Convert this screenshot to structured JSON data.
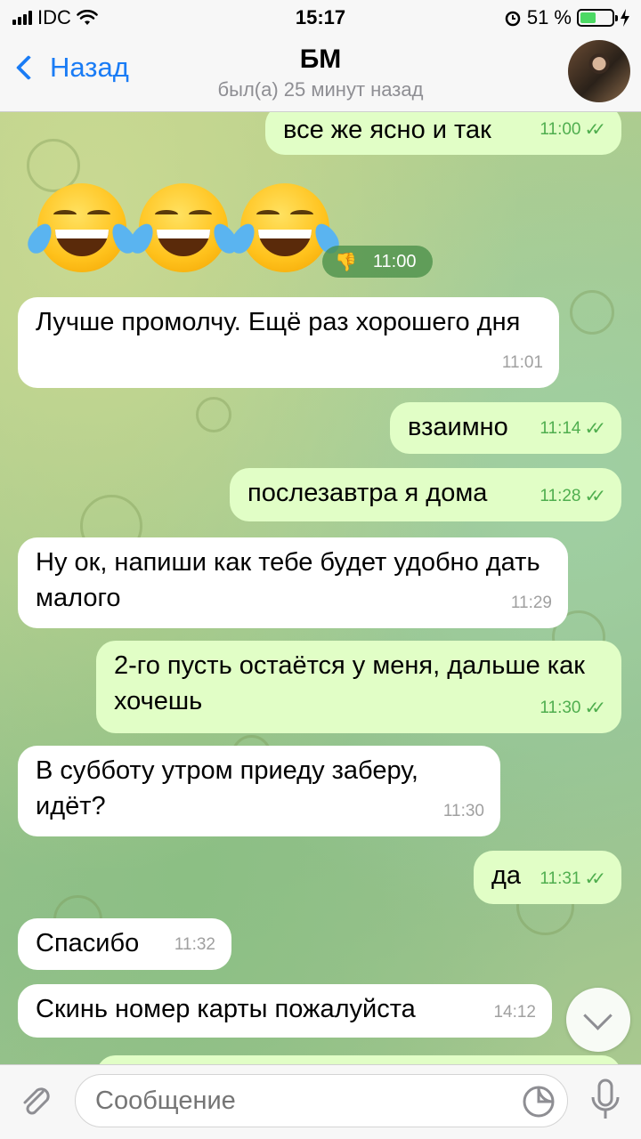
{
  "status": {
    "carrier": "IDC",
    "time": "15:17",
    "battery": "51 %",
    "battery_level": 0.51
  },
  "header": {
    "back_label": "Назад",
    "contact_name": "БМ",
    "last_seen": "был(а) 25 минут назад"
  },
  "messages": [
    {
      "dir": "out",
      "text": "все же ясно и так",
      "time": "11:00"
    },
    {
      "dir": "in-emoji",
      "text": "😂😂😂",
      "time": "11:00",
      "reaction": "👎"
    },
    {
      "dir": "in",
      "text": "Лучше промолчу. Ещё раз хорошего дня",
      "time": "11:01"
    },
    {
      "dir": "out",
      "text": "взаимно",
      "time": "11:14"
    },
    {
      "dir": "out",
      "text": "послезавтра я дома",
      "time": "11:28"
    },
    {
      "dir": "in",
      "text": "Ну ок, напиши как тебе будет удобно дать малого",
      "time": "11:29"
    },
    {
      "dir": "out",
      "text": "2-го пусть остаётся у меня, дальше как хочешь",
      "time": "11:30"
    },
    {
      "dir": "in",
      "text": "В субботу утром приеду заберу, идёт?",
      "time": "11:30"
    },
    {
      "dir": "out",
      "text": "да",
      "time": "11:31"
    },
    {
      "dir": "in",
      "text": "Спасибо",
      "time": "11:32"
    },
    {
      "dir": "in",
      "text": "Скинь номер карты пожалуйста",
      "time": "14:12"
    }
  ],
  "composer": {
    "placeholder": "Сообщение"
  },
  "icons": {
    "back": "chevron-left-icon",
    "attach": "paperclip-icon",
    "sticker": "sticker-icon",
    "mic": "microphone-icon",
    "scroll": "chevron-down-icon"
  }
}
